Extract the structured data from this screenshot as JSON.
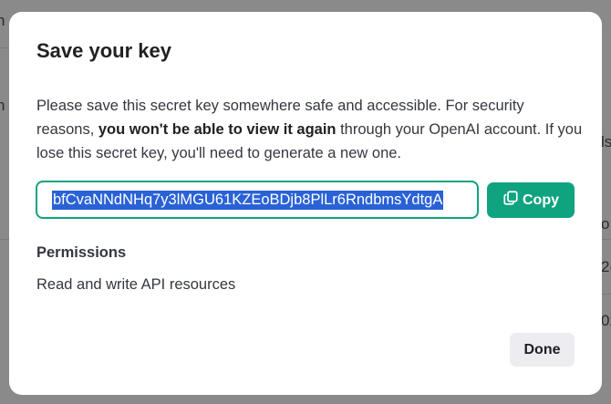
{
  "background": {
    "fragments": [
      "n",
      "n",
      "ls",
      "o",
      "2(",
      "02"
    ]
  },
  "modal": {
    "title": "Save your key",
    "description": {
      "part1": "Please save this secret key somewhere safe and accessible. For security reasons, ",
      "bold": "you won't be able to view it again",
      "part2": " through your OpenAI account. If you lose this secret key, you'll need to generate a new one."
    },
    "secret_key": "bfCvaNNdNHq7y3lMGU61KZEoBDjb8PlLr6RndbmsYdtgA",
    "copy_label": "Copy",
    "permissions_title": "Permissions",
    "permissions_value": "Read and write API resources",
    "done_label": "Done"
  },
  "colors": {
    "accent": "#10a37f",
    "selection": "#2a62d6",
    "overlay": "#8a8a8a",
    "done_bg": "#ececf1"
  },
  "icons": {
    "copy": "copy-icon"
  }
}
